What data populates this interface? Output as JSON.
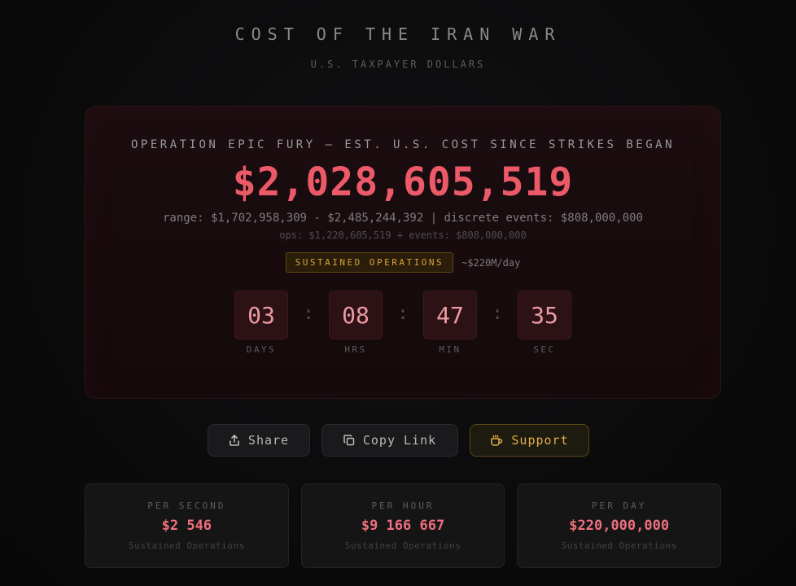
{
  "header": {
    "title": "COST OF THE IRAN WAR",
    "subtitle": "U.S. TAXPAYER DOLLARS"
  },
  "main_card": {
    "heading": "OPERATION EPIC FURY — EST. U.S. COST SINCE STRIKES BEGAN",
    "total": "$2,028,605,519",
    "range_line": "range: $1,702,958,309 - $2,485,244,392 | discrete events: $808,000,000",
    "ops_line": "ops: $1,220,605,519 + events: $808,000,000",
    "status_badge": "SUSTAINED OPERATIONS",
    "rate": "~$220M/day",
    "countdown": {
      "days": "03",
      "hours": "08",
      "minutes": "47",
      "seconds": "35",
      "days_label": "DAYS",
      "hours_label": "HRS",
      "minutes_label": "MIN",
      "seconds_label": "SEC",
      "separator": ":"
    }
  },
  "actions": {
    "share": "Share",
    "copy_link": "Copy Link",
    "support": "Support"
  },
  "stats": [
    {
      "label": "PER SECOND",
      "value": "$2 546",
      "sub": "Sustained Operations"
    },
    {
      "label": "PER HOUR",
      "value": "$9 166 667",
      "sub": "Sustained Operations"
    },
    {
      "label": "PER DAY",
      "value": "$220,000,000",
      "sub": "Sustained Operations"
    }
  ],
  "icons": {
    "share": "share-icon",
    "copy": "copy-icon",
    "support": "coffee-icon"
  },
  "colors": {
    "accent_red": "#ec5a69",
    "accent_gold": "#d6a23c",
    "background": "#0b0b0c"
  }
}
